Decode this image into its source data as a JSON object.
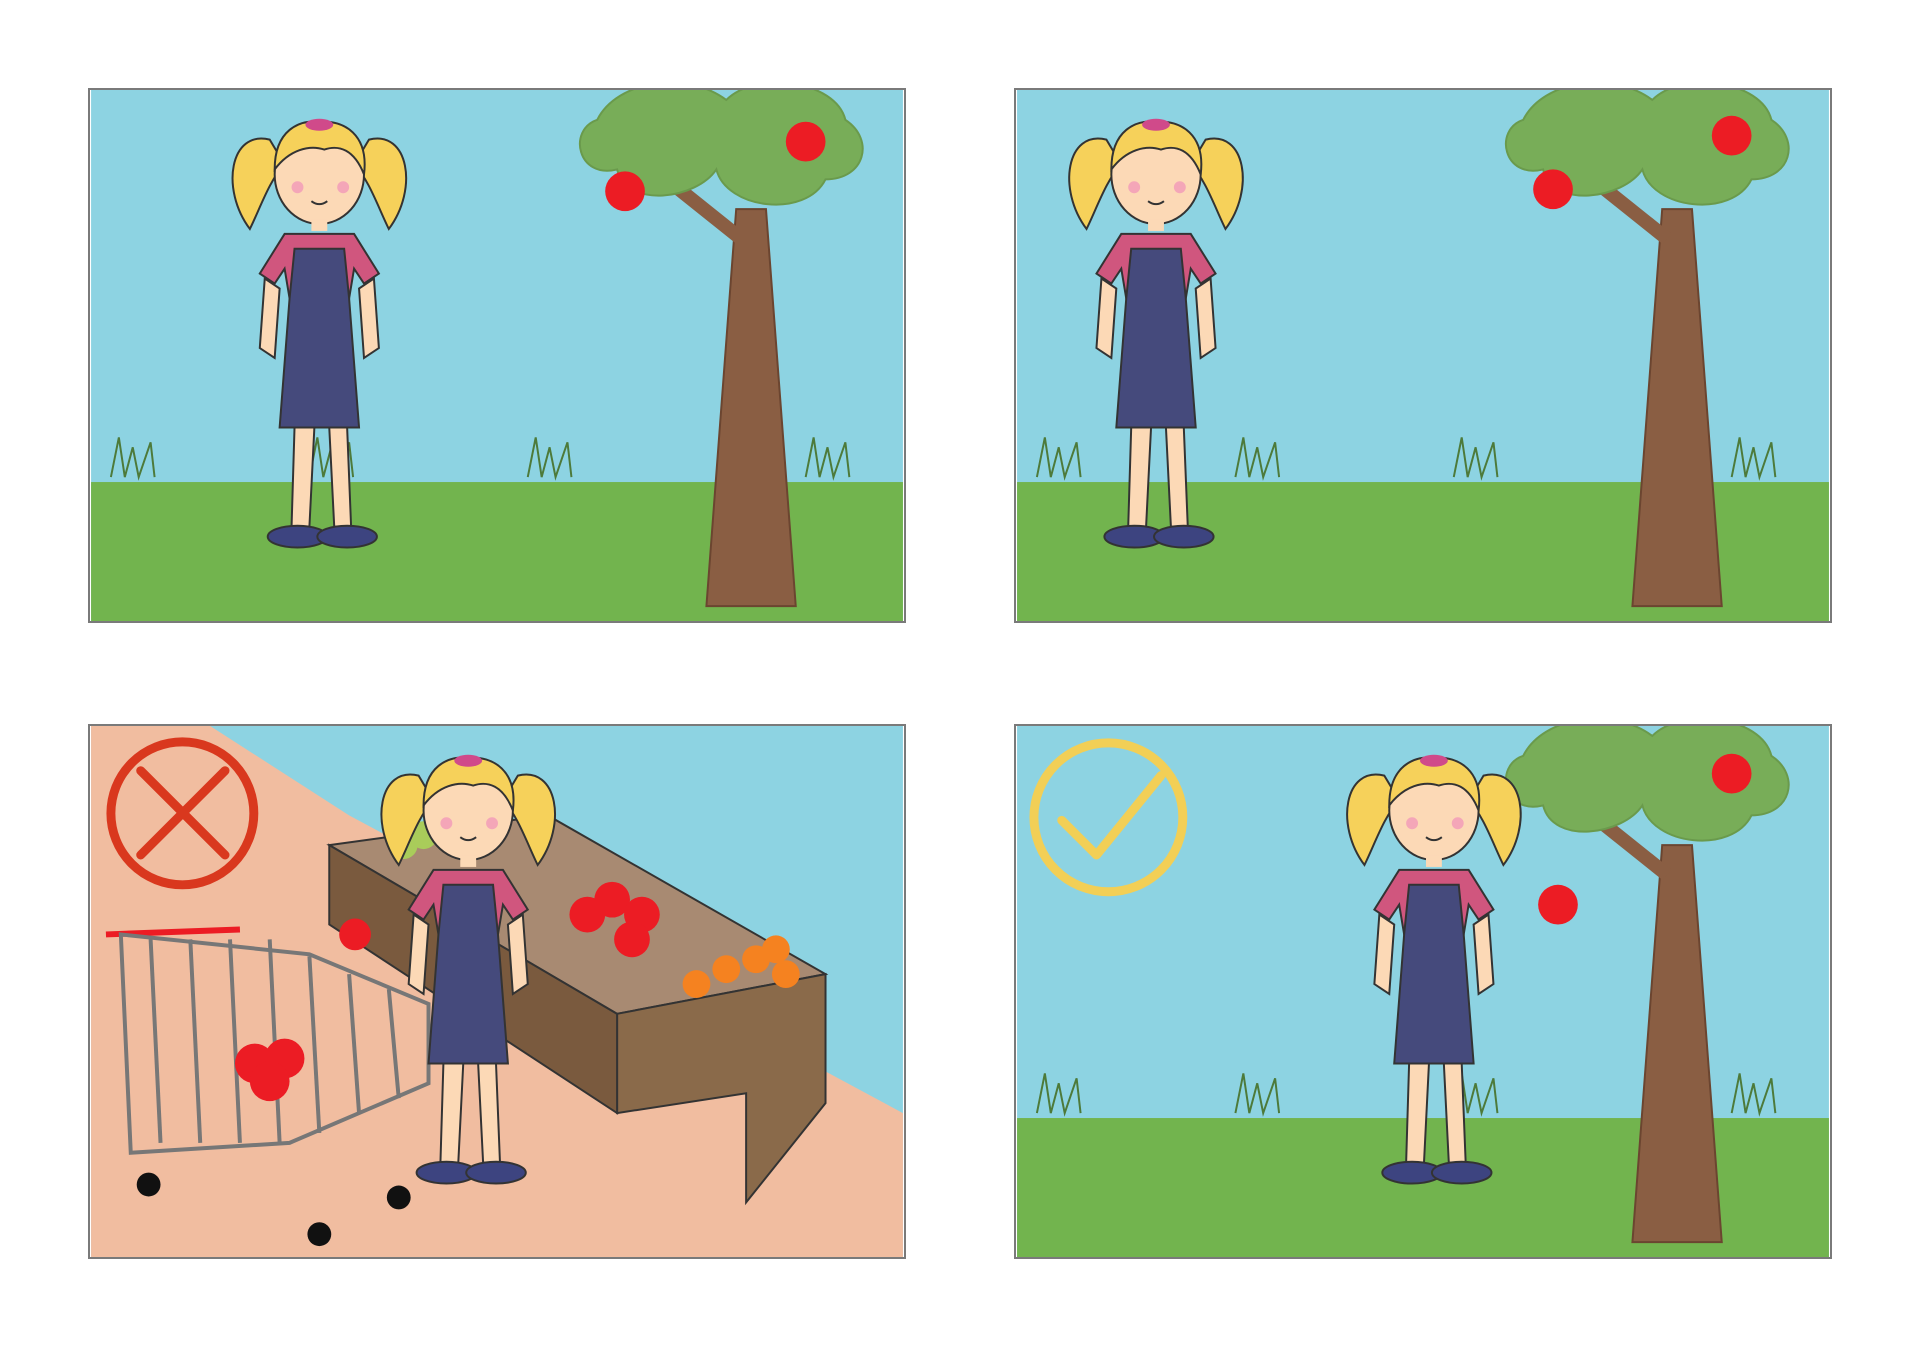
{
  "panels": [
    {
      "id": "walking",
      "scene": "park"
    },
    {
      "id": "noticing-apple",
      "scene": "park"
    },
    {
      "id": "store-taking-apple",
      "scene": "grocery-store",
      "verdict": "wrong"
    },
    {
      "id": "tree-apple",
      "scene": "park",
      "verdict": "right"
    }
  ],
  "colors": {
    "sky": "#8dd3e2",
    "grass": "#72b44e",
    "tree_canopy": "#78ad58",
    "trunk": "#8a5e43",
    "apple": "#ec1c24",
    "wrong_mark": "#d9381e",
    "right_mark": "#f2cf56",
    "floor": "#f1bda0"
  },
  "icons": {
    "wrong": "cross-circle-icon",
    "right": "check-circle-icon"
  }
}
